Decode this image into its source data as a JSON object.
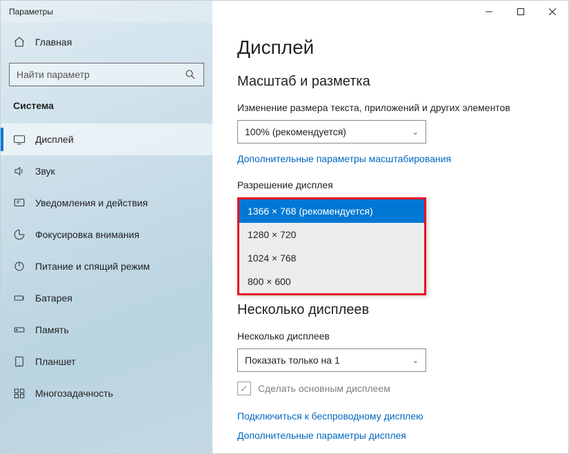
{
  "window_title": "Параметры",
  "sidebar": {
    "home_label": "Главная",
    "search_placeholder": "Найти параметр",
    "section_label": "Система",
    "items": [
      {
        "label": "Дисплей"
      },
      {
        "label": "Звук"
      },
      {
        "label": "Уведомления и действия"
      },
      {
        "label": "Фокусировка внимания"
      },
      {
        "label": "Питание и спящий режим"
      },
      {
        "label": "Батарея"
      },
      {
        "label": "Память"
      },
      {
        "label": "Планшет"
      },
      {
        "label": "Многозадачность"
      }
    ]
  },
  "main": {
    "page_title": "Дисплей",
    "section_scale": "Масштаб и разметка",
    "scale_label": "Изменение размера текста, приложений и других элементов",
    "scale_value": "100% (рекомендуется)",
    "advanced_link": "Дополнительные параметры масштабирования",
    "resolution_label": "Разрешение дисплея",
    "resolution_options": [
      "1366 × 768 (рекомендуется)",
      "1280 × 720",
      "1024 × 768",
      "800 × 600"
    ],
    "section_multi": "Несколько дисплеев",
    "multi_label": "Несколько дисплеев",
    "multi_value": "Показать только на 1",
    "make_primary": "Сделать основным дисплеем",
    "wireless_link": "Подключиться к беспроводному дисплею",
    "advanced_display_link": "Дополнительные параметры дисплея"
  }
}
